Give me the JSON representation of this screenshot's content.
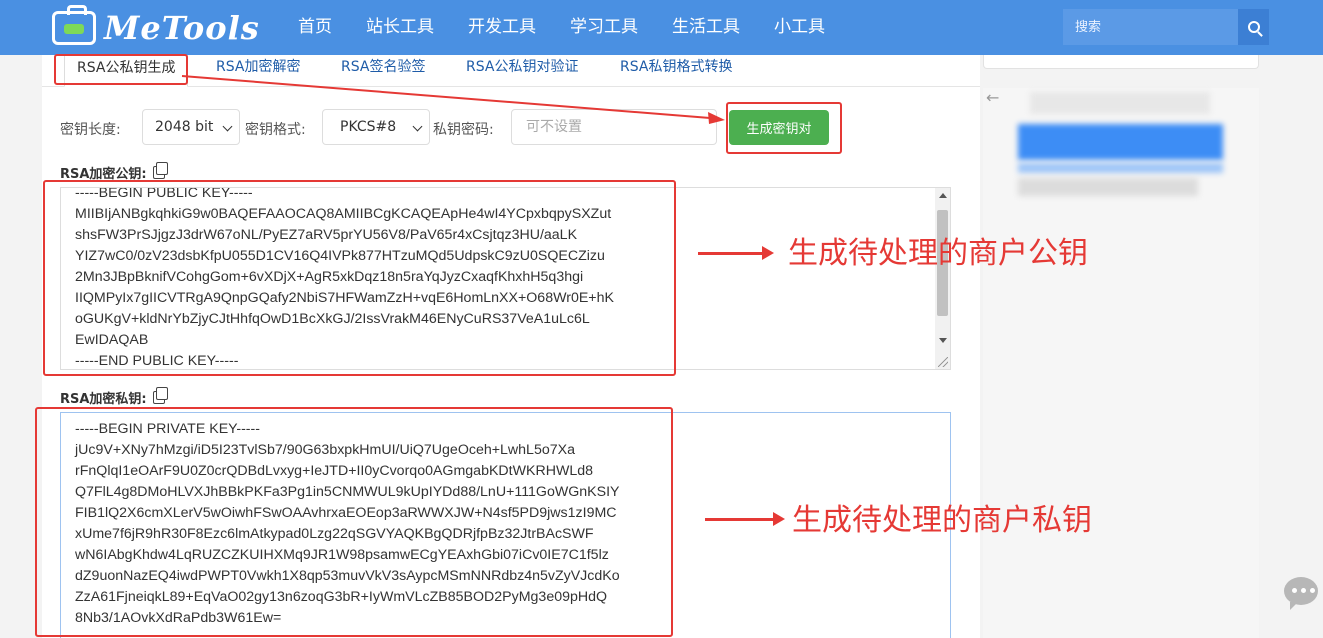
{
  "header": {
    "logo_text": "MeTools",
    "nav": [
      "首页",
      "站长工具",
      "开发工具",
      "学习工具",
      "生活工具",
      "小工具"
    ],
    "search_placeholder": "搜索"
  },
  "tabs": [
    "RSA公私钥生成",
    "RSA加密解密",
    "RSA签名验签",
    "RSA公私钥对验证",
    "RSA私钥格式转换"
  ],
  "options": {
    "key_length_label": "密钥长度:",
    "key_length_value": "2048 bit",
    "key_format_label": "密钥格式:",
    "key_format_value": "PKCS#8",
    "private_password_label": "私钥密码:",
    "private_password_placeholder": "可不设置",
    "generate_button": "生成密钥对"
  },
  "public_key": {
    "title": "RSA加密公钥:",
    "text": "-----BEGIN PUBLIC KEY-----\nMIIBIjANBgkqhkiG9w0BAQEFAAOCAQ8AMIIBCgKCAQEApHe4wI4YCpxbqpySXZut\nshsFW3PrSJjgzJ3drW67oNL/PyEZ7aRV5prYU56V8/PaV65r4xCsjtqz3HU/aaLK\nYIZ7wC0/0zV23dsbKfpU055D1CV16Q4IVPk877HTzuMQd5UdpskC9zU0SQECZizu\n2Mn3JBpBknifVCohgGom+6vXDjX+AgR5xkDqz18n5raYqJyzCxaqfKhxhH5q3hgi\nIIQMPyIx7gIICVTRgA9QnpGQafy2NbiS7HFWamZzH+vqE6HomLnXX+O68Wr0E+hK\noGUKgV+kldNrYbZjyCJtHhfqOwD1BcXkGJ/2IssVrakM46ENyCuRS37VeA1uLc6L\nEwIDAQAB\n-----END PUBLIC KEY-----"
  },
  "private_key": {
    "title": "RSA加密私钥:",
    "text": "-----BEGIN PRIVATE KEY-----\njUc9V+XNy7hMzgi/iD5I23TvlSb7/90G63bxpkHmUI/UiQ7UgeOceh+LwhL5o7Xa\nrFnQlqI1eOArF9U0Z0crQDBdLvxyg+IeJTD+II0yCvorqo0AGmgabKDtWKRHWLd8\nQ7FlL4g8DMoHLVXJhBBkPKFa3Pg1in5CNMWUL9kUpIYDd88/LnU+111GoWGnKSIY\nFIB1lQ2X6cmXLerV5wOiwhFSwOAAvhrxaEOEop3aRWWXJW+N4sf5PD9jws1zI9MC\nxUme7f6jR9hR30F8Ezc6lmAtkypad0Lzg22qSGVYAQKBgQDRjfpBz32JtrBAcSWF\nwN6IAbgKhdw4LqRUZCZKUIHXMq9JR1W98psamwECgYEAxhGbi07iCv0IE7C1f5lz\ndZ9uonNazEQ4iwdPWPT0Vwkh1X8qp53muvVkV3sAypcMSmNNRdbz4n5vZyVJcdKo\nZzA61FjneiqkL89+EqVaO02gy13n6zoqG3bR+IyWmVLcZB85BOD2PyMg3e09pHdQ\n8Nb3/1AOvkXdRaPdb3W61Ew="
  },
  "annotations": {
    "public": "生成待处理的商户公钥",
    "private": "生成待处理的商户私钥"
  }
}
